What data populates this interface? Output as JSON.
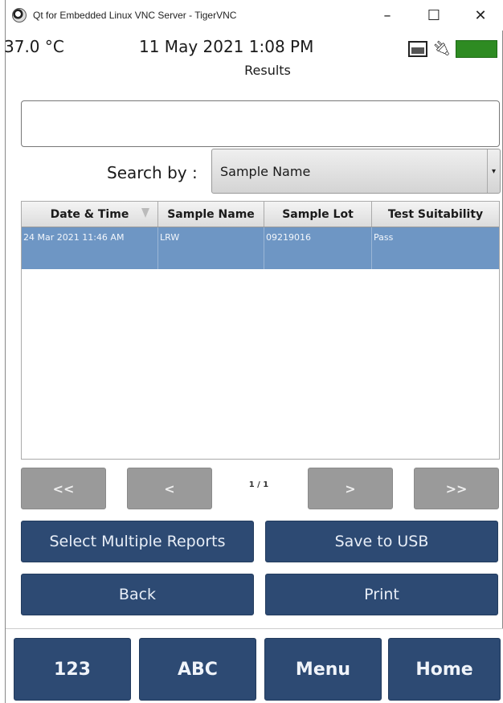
{
  "window": {
    "title": "Qt for Embedded Linux VNC Server - TigerVNC",
    "minimize": "–",
    "maximize": "☐",
    "close": "✕"
  },
  "status": {
    "temperature": "37.0 °C",
    "datetime": "11 May 2021 1:08 PM",
    "screen_title": "Results"
  },
  "search": {
    "value": "",
    "label": "Search by :",
    "selected": "Sample Name"
  },
  "table": {
    "columns": [
      "Date & Time",
      "Sample Name",
      "Sample Lot",
      "Test Suitability"
    ],
    "rows": [
      [
        "24 Mar 2021 11:46 AM",
        "LRW",
        "09219016",
        "Pass"
      ]
    ]
  },
  "pager": {
    "first": "<<",
    "prev": "<",
    "indicator": "1 / 1",
    "next": ">",
    "last": ">>"
  },
  "actions": {
    "select_multiple": "Select Multiple Reports",
    "save_usb": "Save to USB",
    "back": "Back",
    "print": "Print"
  },
  "nav": {
    "num": "123",
    "abc": "ABC",
    "menu": "Menu",
    "home": "Home"
  },
  "colors": {
    "primary": "#2d4a73",
    "selected_row": "#6e96c4",
    "disabled": "#9a9a9a",
    "battery": "#2e8b22"
  }
}
